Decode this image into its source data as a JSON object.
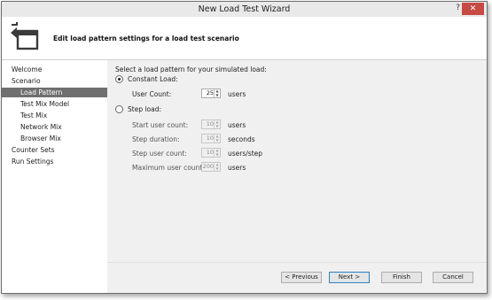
{
  "window": {
    "title": "New Load Test Wizard",
    "help_glyph": "?",
    "close_glyph": "✕"
  },
  "header": {
    "text": "Edit load pattern settings for a load test scenario",
    "icon": "wizard-arrow-document-icon"
  },
  "sidebar": {
    "items": [
      {
        "label": "Welcome",
        "level": 0,
        "selected": false
      },
      {
        "label": "Scenario",
        "level": 0,
        "selected": false
      },
      {
        "label": "Load Pattern",
        "level": 1,
        "selected": true
      },
      {
        "label": "Test Mix Model",
        "level": 1,
        "selected": false
      },
      {
        "label": "Test Mix",
        "level": 1,
        "selected": false
      },
      {
        "label": "Network Mix",
        "level": 1,
        "selected": false
      },
      {
        "label": "Browser Mix",
        "level": 1,
        "selected": false
      },
      {
        "label": "Counter Sets",
        "level": 0,
        "selected": false
      },
      {
        "label": "Run Settings",
        "level": 0,
        "selected": false
      }
    ]
  },
  "main": {
    "prompt": "Select a load pattern for your simulated load:",
    "constant": {
      "label": "Constant Load:",
      "selected": true,
      "user_count_label": "User Count:",
      "user_count_value": "25",
      "user_count_unit": "users"
    },
    "step": {
      "label": "Step load:",
      "selected": false,
      "fields": [
        {
          "label": "Start user count:",
          "value": "10",
          "unit": "users"
        },
        {
          "label": "Step duration:",
          "value": "10",
          "unit": "seconds"
        },
        {
          "label": "Step user count:",
          "value": "10",
          "unit": "users/step"
        },
        {
          "label": "Maximum user count:",
          "value": "200",
          "unit": "users"
        }
      ]
    }
  },
  "footer": {
    "previous": "< Previous",
    "next": "Next >",
    "finish": "Finish",
    "cancel": "Cancel"
  },
  "colors": {
    "selected_nav": "#6f6f6f",
    "panel": "#f0f0f0",
    "close_button": "#c74b44"
  }
}
